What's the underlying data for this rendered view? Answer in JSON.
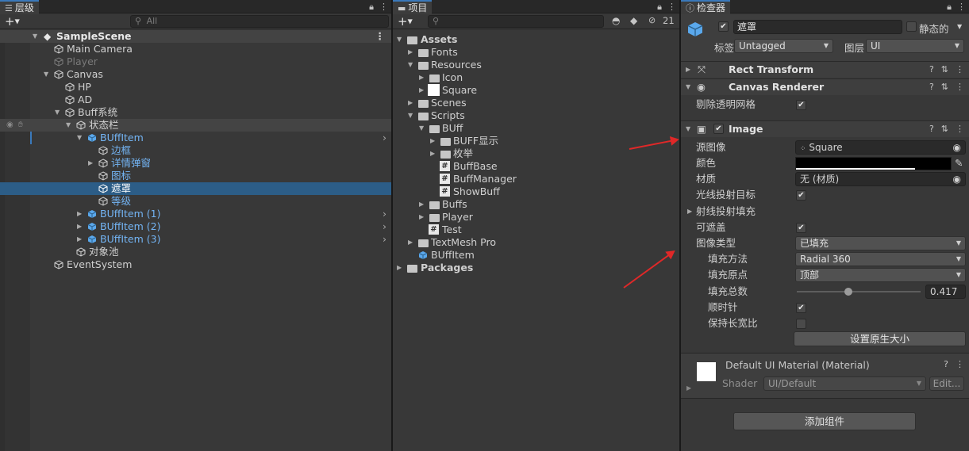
{
  "hierarchy": {
    "tab_label": "层级",
    "search_placeholder": "All",
    "scene_name": "SampleScene",
    "items": [
      {
        "label": "Main Camera"
      },
      {
        "label": "Player"
      },
      {
        "label": "Canvas"
      },
      {
        "label": "HP"
      },
      {
        "label": "AD"
      },
      {
        "label": "Buff系统"
      },
      {
        "label": "状态栏"
      },
      {
        "label": "BUffItem"
      },
      {
        "label": "边框"
      },
      {
        "label": "详情弹窗"
      },
      {
        "label": "图标"
      },
      {
        "label": "遮罩"
      },
      {
        "label": "等级"
      },
      {
        "label": "BUffItem (1)"
      },
      {
        "label": "BUffItem (2)"
      },
      {
        "label": "BUffItem (3)"
      },
      {
        "label": "对象池"
      },
      {
        "label": "EventSystem"
      }
    ]
  },
  "project": {
    "tab_label": "项目",
    "hidden_count": "21",
    "items": [
      {
        "label": "Assets"
      },
      {
        "label": "Fonts"
      },
      {
        "label": "Resources"
      },
      {
        "label": "Icon"
      },
      {
        "label": "Square"
      },
      {
        "label": "Scenes"
      },
      {
        "label": "Scripts"
      },
      {
        "label": "BUff"
      },
      {
        "label": "BUFF显示"
      },
      {
        "label": "枚举"
      },
      {
        "label": "BuffBase"
      },
      {
        "label": "BuffManager"
      },
      {
        "label": "ShowBuff"
      },
      {
        "label": "Buffs"
      },
      {
        "label": "Player"
      },
      {
        "label": "Test"
      },
      {
        "label": "TextMesh Pro"
      },
      {
        "label": "BUffItem"
      },
      {
        "label": "Packages"
      }
    ]
  },
  "inspector": {
    "tab_label": "检查器",
    "object_name": "遮罩",
    "static_label": "静态的",
    "tag_label": "标签",
    "tag_value": "Untagged",
    "layer_label": "图层",
    "layer_value": "UI",
    "rect_transform": "Rect Transform",
    "canvas_renderer": "Canvas Renderer",
    "cull_label": "剔除透明网格",
    "image_title": "Image",
    "source_image_label": "源图像",
    "source_image_value": "Square",
    "color_label": "颜色",
    "material_label": "材质",
    "material_value": "无 (材质)",
    "raycast_target_label": "光线投射目标",
    "raycast_padding_label": "射线投射填充",
    "maskable_label": "可遮盖",
    "image_type_label": "图像类型",
    "image_type_value": "已填充",
    "fill_method_label": "填充方法",
    "fill_method_value": "Radial 360",
    "fill_origin_label": "填充原点",
    "fill_origin_value": "顶部",
    "fill_amount_label": "填充总数",
    "fill_amount_value": "0.417",
    "fill_amount": 0.417,
    "clockwise_label": "顺时针",
    "preserve_aspect_label": "保持长宽比",
    "set_native_size": "设置原生大小",
    "material_title": "Default UI Material (Material)",
    "shader_label": "Shader",
    "shader_value": "UI/Default",
    "edit_label": "Edit...",
    "add_component": "添加组件"
  },
  "colors": {
    "selection": "#2c5d87",
    "tab_accent": "#3a79bb",
    "annotation_arrow": "#e02828",
    "prefab_blue": "#73b4f4"
  }
}
